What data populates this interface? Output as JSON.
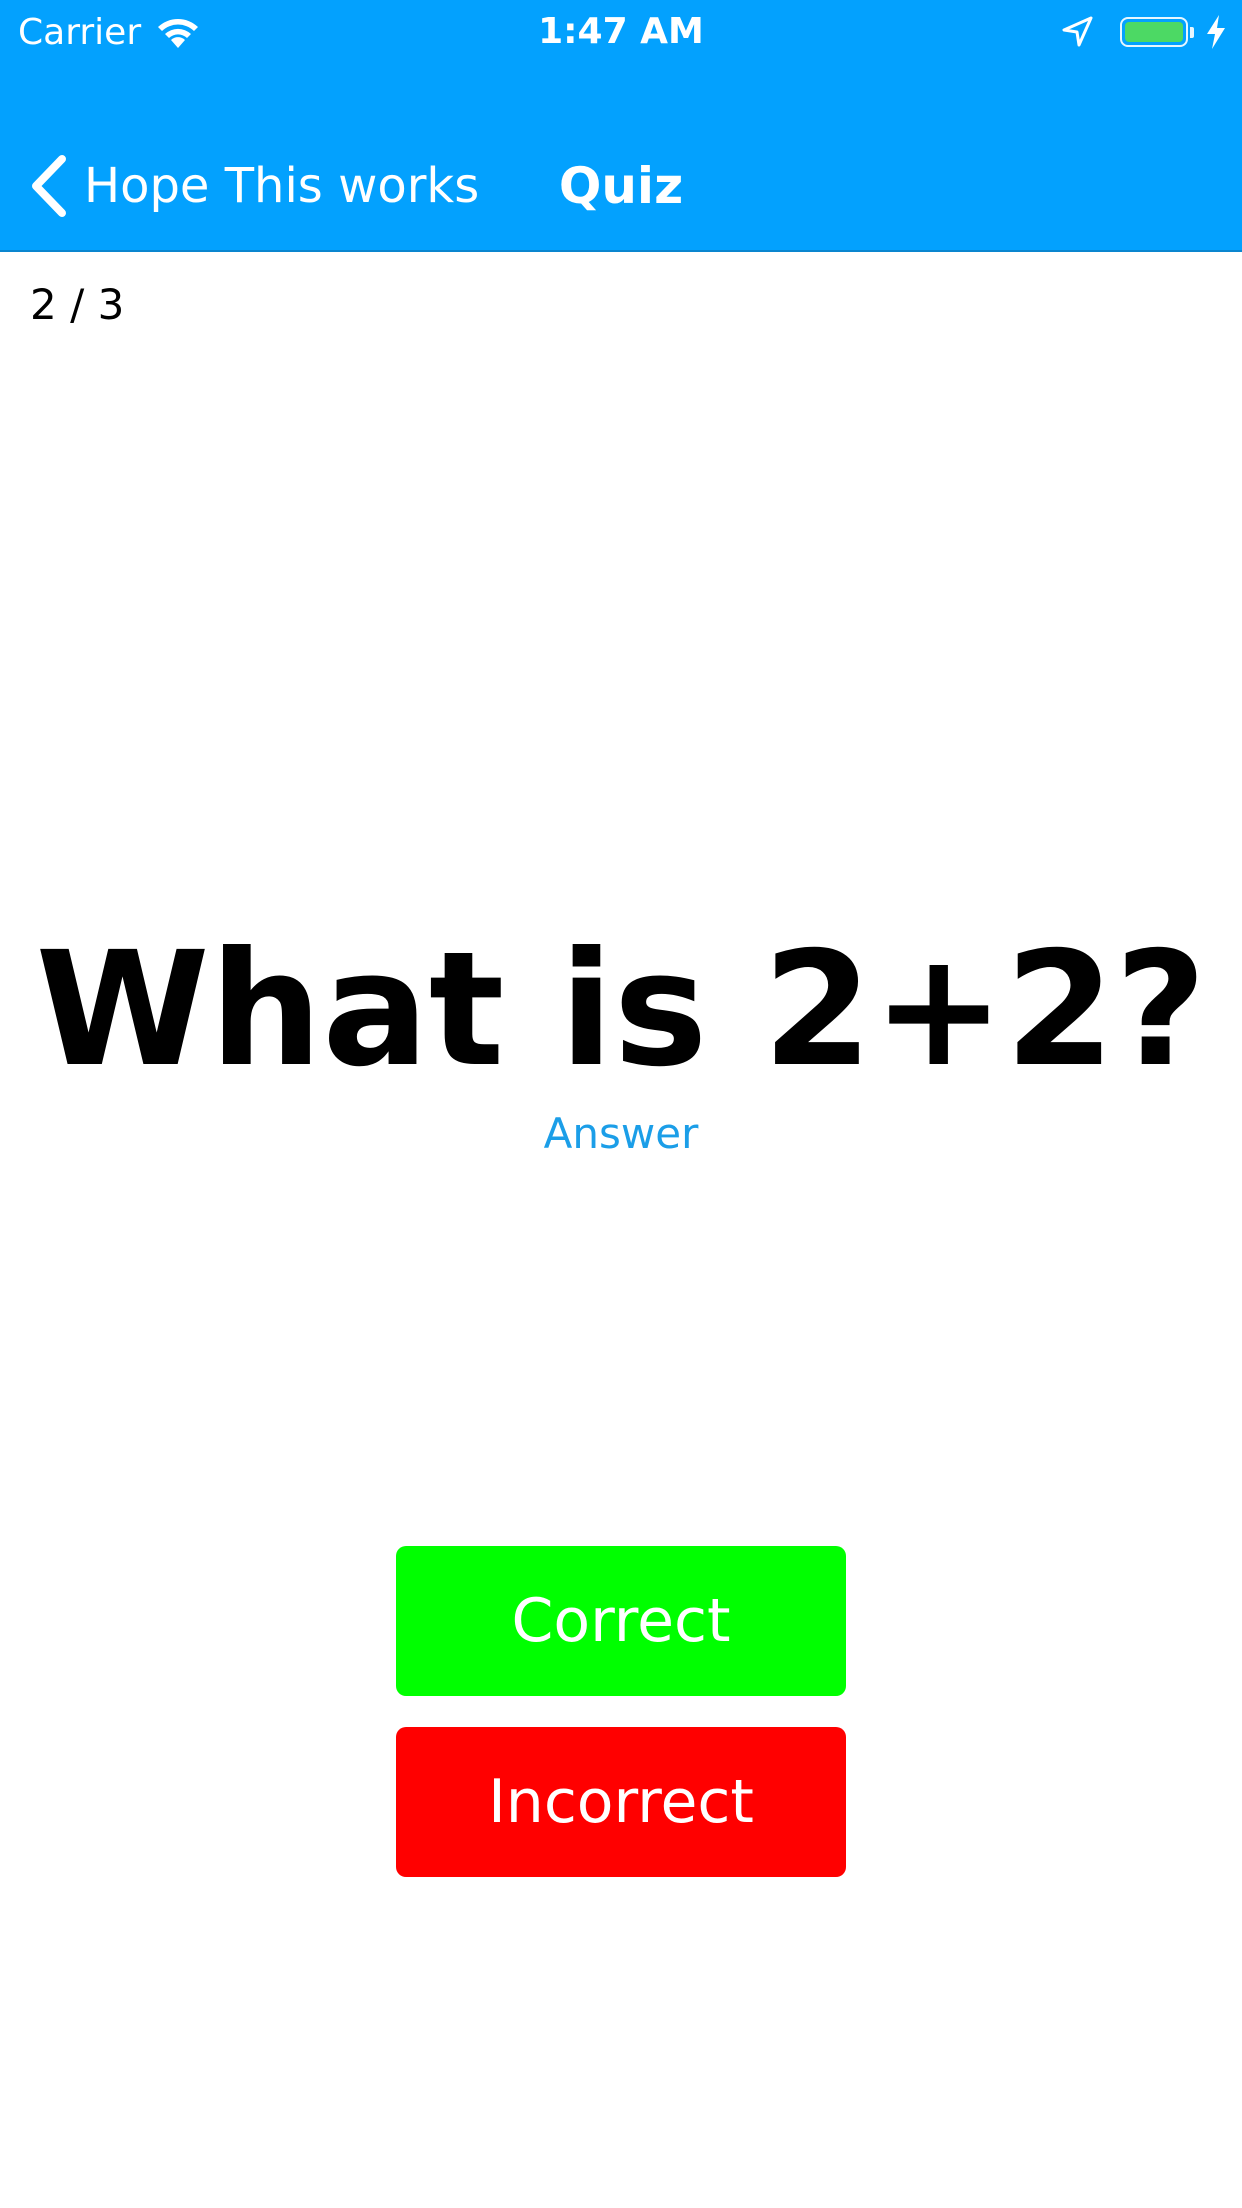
{
  "status_bar": {
    "carrier": "Carrier",
    "time": "1:47 AM",
    "battery_level": 1.0,
    "icons": [
      "wifi-icon",
      "location-arrow-icon",
      "battery-icon",
      "charging-bolt-icon"
    ]
  },
  "nav_bar": {
    "back_label": "Hope This works",
    "title": "Quiz",
    "background_color": "#03a1fe"
  },
  "quiz": {
    "progress": "2 / 3",
    "question": "What is 2+2?",
    "answer_label": "Answer",
    "correct_label": "Correct",
    "incorrect_label": "Incorrect",
    "correct_color": "#00ff00",
    "incorrect_color": "#ff0000",
    "answer_color": "#1b9ee8"
  }
}
